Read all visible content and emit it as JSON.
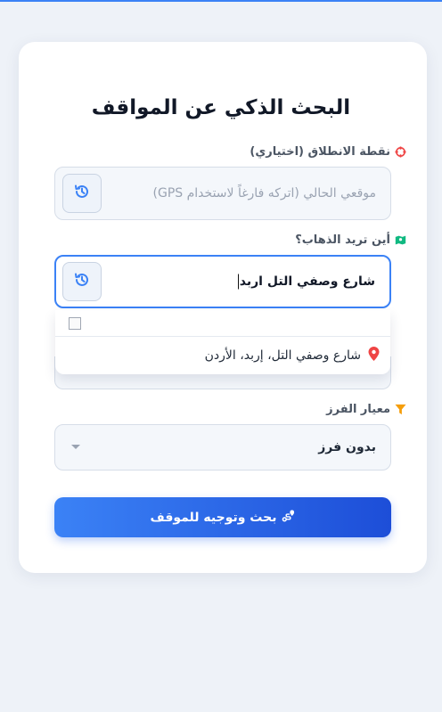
{
  "page": {
    "title": "البحث الذكي عن المواقف"
  },
  "start": {
    "label": "نقطة الانطلاق (اختياري)",
    "icon": "crosshairs-icon",
    "placeholder": "موقعي الحالي (اتركه فارغاً لاستخدام GPS)",
    "history_icon": "history-icon"
  },
  "destination": {
    "label": "أين تريد الذهاب؟",
    "icon": "map-icon",
    "value": "شارع وصفي التل اربد",
    "history_icon": "history-icon",
    "suggestions": [
      {
        "text": "شارع وصفي التل، إربد، الأردن",
        "icon": "location-pin-icon"
      }
    ]
  },
  "sort": {
    "label": "معيار الفرز",
    "icon": "filter-icon",
    "selected": "بدون فرز"
  },
  "submit": {
    "label": "بحث وتوجيه للموقف",
    "icon": "route-icon"
  },
  "colors": {
    "accent": "#3b82f6",
    "accent_dark": "#1d4ed8",
    "start_icon": "#ef4444",
    "map_icon": "#10b981",
    "filter_icon": "#f59e0b"
  }
}
